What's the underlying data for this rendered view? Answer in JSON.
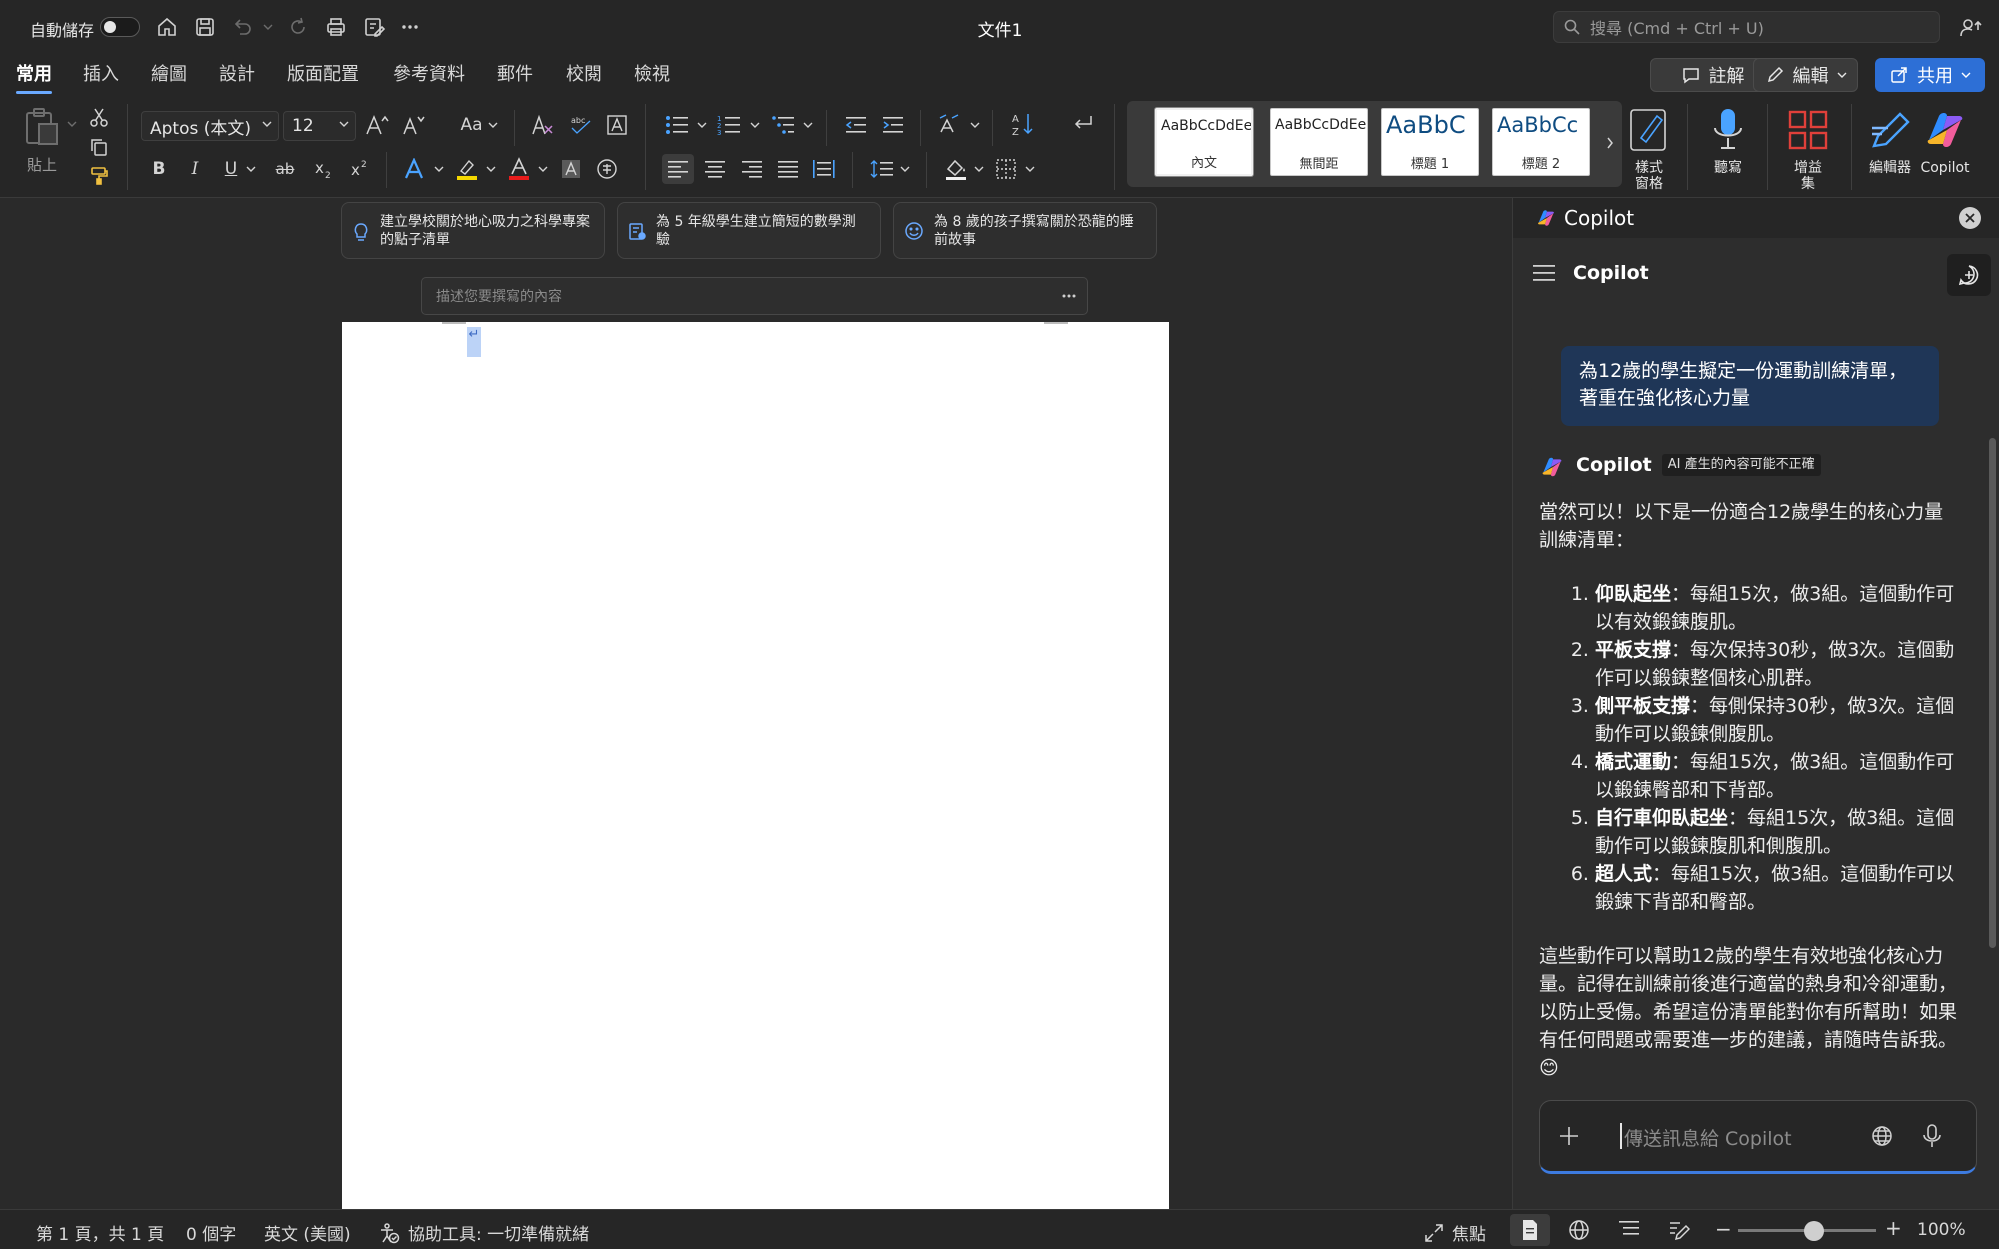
{
  "titlebar": {
    "autosave_label": "自動儲存",
    "document_title": "文件1",
    "search_placeholder": "搜尋 (Cmd + Ctrl + U)"
  },
  "tabs": [
    {
      "label": "常用",
      "active": true
    },
    {
      "label": "插入"
    },
    {
      "label": "繪圖"
    },
    {
      "label": "設計"
    },
    {
      "label": "版面配置"
    },
    {
      "label": "參考資料"
    },
    {
      "label": "郵件"
    },
    {
      "label": "校閱"
    },
    {
      "label": "檢視"
    }
  ],
  "actions": {
    "comments_label": "註解",
    "editing_label": "編輯",
    "share_label": "共用"
  },
  "ribbon": {
    "paste_label": "貼上",
    "font_name": "Aptos (本文)",
    "font_size": "12",
    "change_case_label": "Aa",
    "styles": [
      {
        "preview": "AaBbCcDdEe",
        "caption": "內文",
        "selected": true
      },
      {
        "preview": "AaBbCcDdEe",
        "caption": "無間距"
      },
      {
        "preview": "AaBbC",
        "caption": "標題 1"
      },
      {
        "preview": "AaBbCc",
        "caption": "標題 2"
      }
    ],
    "styles_pane_label": "樣式\n窗格",
    "dictate_label": "聽寫",
    "addins_label": "增益\n集",
    "editor_label": "編輯器",
    "copilot_label": "Copilot",
    "accent_colors": {
      "highlight": "#f5d800",
      "font_color": "#e81c1c"
    }
  },
  "document": {
    "prompt_cards": [
      {
        "text": "建立學校關於地心吸力之科學專案的點子清單",
        "icon": "lightbulb-icon"
      },
      {
        "text": "為 5 年級學生建立簡短的數學測驗",
        "icon": "quiz-icon"
      },
      {
        "text": "為 8 歲的孩子撰寫關於恐龍的睡前故事",
        "icon": "smile-icon"
      }
    ],
    "describe_placeholder": "描述您要撰寫的內容",
    "paragraph_mark": "↵"
  },
  "copilot": {
    "pane_title": "Copilot",
    "chat_title": "Copilot",
    "user_message": "為12歲的學生擬定一份運動訓練清單，著重在強化核心力量",
    "assistant_name": "Copilot",
    "ai_badge": "AI 產生的內容可能不正確",
    "intro": "當然可以！以下是一份適合12歲學生的核心力量訓練清單：",
    "items": [
      {
        "name": "仰臥起坐",
        "detail": "：每組15次，做3組。這個動作可以有效鍛鍊腹肌。"
      },
      {
        "name": "平板支撐",
        "detail": "：每次保持30秒，做3次。這個動作可以鍛鍊整個核心肌群。"
      },
      {
        "name": "側平板支撐",
        "detail": "：每側保持30秒，做3次。這個動作可以鍛鍊側腹肌。"
      },
      {
        "name": "橋式運動",
        "detail": "：每組15次，做3組。這個動作可以鍛鍊臀部和下背部。"
      },
      {
        "name": "自行車仰臥起坐",
        "detail": "：每組15次，做3組。這個動作可以鍛鍊腹肌和側腹肌。"
      },
      {
        "name": "超人式",
        "detail": "：每組15次，做3組。這個動作可以鍛鍊下背部和臀部。"
      }
    ],
    "outro": "這些動作可以幫助12歲的學生有效地強化核心力量。記得在訓練前後進行適當的熱身和冷卻運動，以防止受傷。希望這份清單能對你有所幫助！如果有任何問題或需要進一步的建議，請隨時告訴我。😊",
    "composer_placeholder": "傳送訊息給 Copilot"
  },
  "statusbar": {
    "page_info": "第 1 頁，共 1 頁",
    "word_count": "0 個字",
    "language": "英文 (美國)",
    "accessibility": "協助工具: 一切準備就緒",
    "focus_label": "焦點",
    "zoom": "100%",
    "zoom_fraction": 0.55
  }
}
